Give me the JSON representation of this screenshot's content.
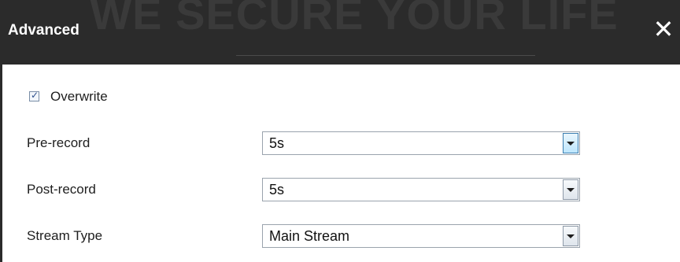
{
  "dialog": {
    "title": "Advanced",
    "close_glyph": "✕",
    "watermark": "WE SECURE YOUR LIFE"
  },
  "overwrite": {
    "label": "Overwrite",
    "checked": true
  },
  "pre_record": {
    "label": "Pre-record",
    "value": "5s"
  },
  "post_record": {
    "label": "Post-record",
    "value": "5s"
  },
  "stream_type": {
    "label": "Stream Type",
    "value": "Main Stream"
  }
}
